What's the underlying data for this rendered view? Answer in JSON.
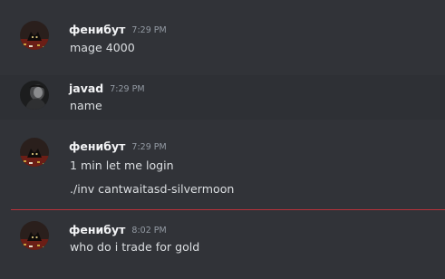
{
  "messages": [
    {
      "author": "фенибут",
      "timestamp": "7:29 PM",
      "lines": [
        "mage 4000"
      ]
    },
    {
      "author": "javad",
      "timestamp": "7:29 PM",
      "lines": [
        "name"
      ]
    },
    {
      "author": "фенибут",
      "timestamp": "7:29 PM",
      "lines": [
        "1 min let me login",
        "./inv cantwaitasd-silvermoon"
      ]
    },
    {
      "author": "фенибут",
      "timestamp": "8:02 PM",
      "lines": [
        "who do i trade for gold"
      ]
    }
  ],
  "colors": {
    "background": "#313338",
    "hover_background": "#2e3035",
    "new_messages_divider": "#b8323b",
    "author": "#f2f3f5",
    "timestamp": "#949ba4",
    "text": "#dbdee1"
  }
}
